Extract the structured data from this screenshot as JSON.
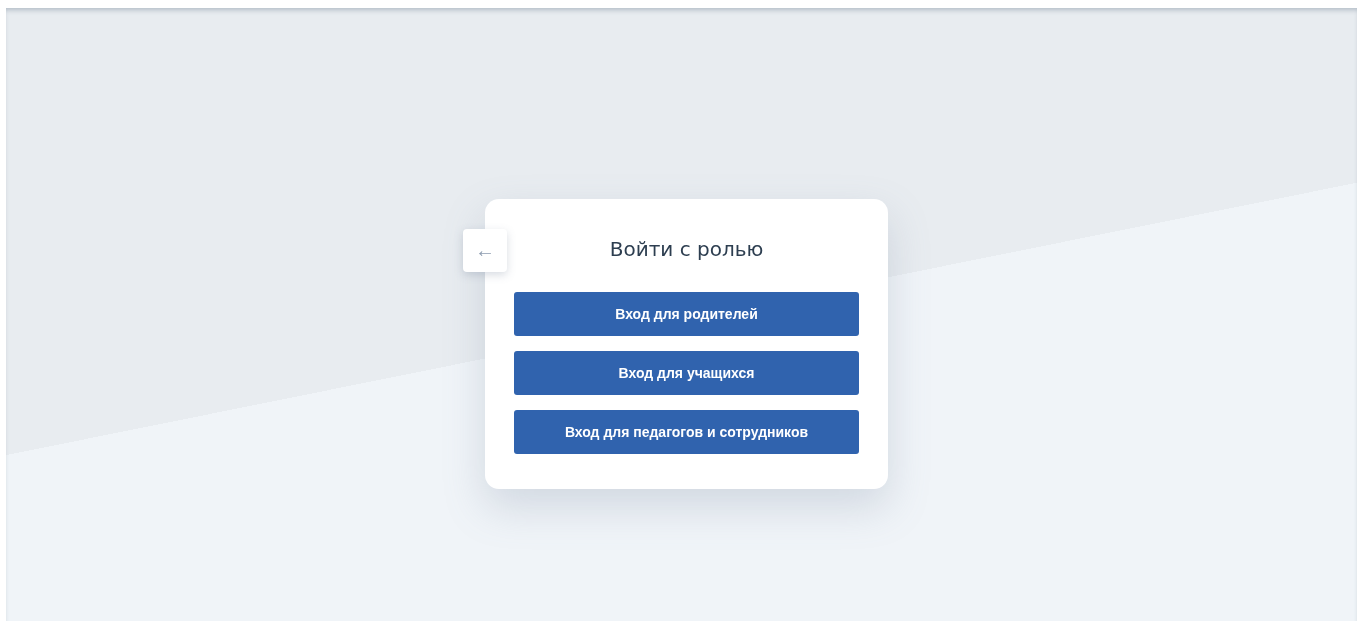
{
  "back_button": {
    "label": "←"
  },
  "dialog": {
    "title": "Войти с ролью",
    "buttons": [
      {
        "label": "Вход для родителей"
      },
      {
        "label": "Вход для учащихся"
      },
      {
        "label": "Вход для педагогов и сотрудников"
      }
    ]
  }
}
